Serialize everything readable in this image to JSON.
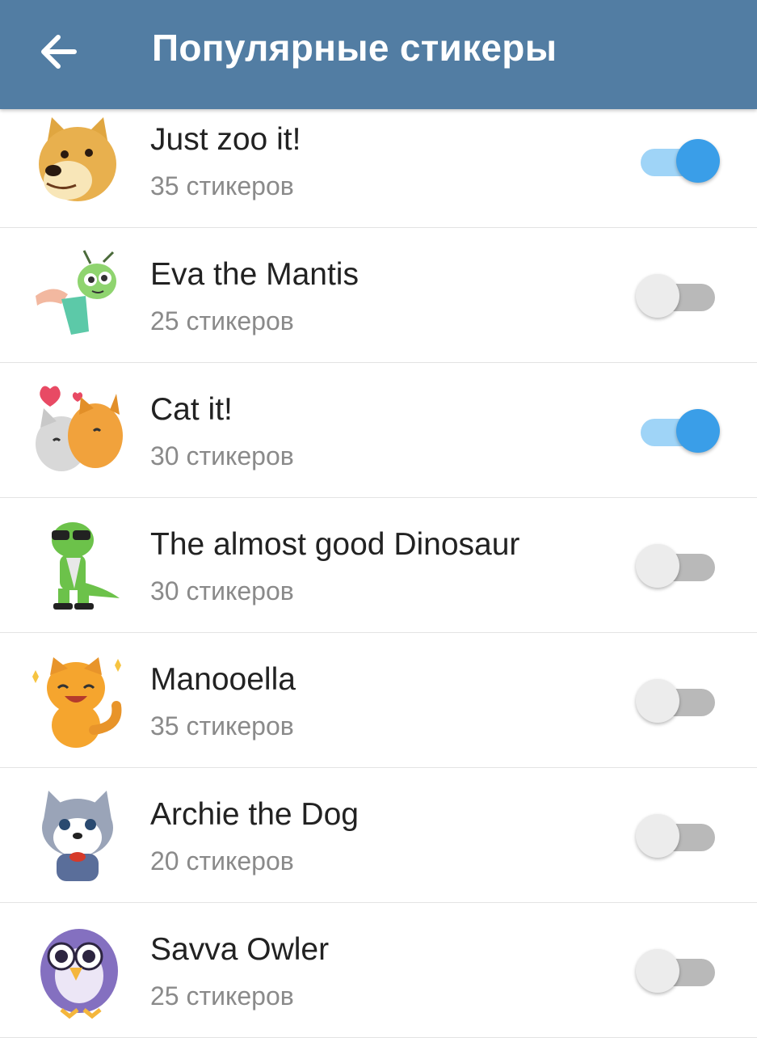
{
  "header": {
    "back_icon": "arrow-back-icon",
    "title": "Популярные стикеры",
    "background": "#527da3"
  },
  "packs": [
    {
      "name": "Just zoo it!",
      "count": "35 стикеров",
      "enabled": true,
      "icon": "doge-sticker"
    },
    {
      "name": "Eva the Mantis",
      "count": "25 стикеров",
      "enabled": false,
      "icon": "mantis-sticker"
    },
    {
      "name": "Cat it!",
      "count": "30 стикеров",
      "enabled": true,
      "icon": "cats-hug-sticker"
    },
    {
      "name": "The almost good Dinosaur",
      "count": "30 стикеров",
      "enabled": false,
      "icon": "dinosaur-sticker"
    },
    {
      "name": "Manooella",
      "count": "35 стикеров",
      "enabled": false,
      "icon": "orange-cat-sticker"
    },
    {
      "name": "Archie the Dog",
      "count": "20 стикеров",
      "enabled": false,
      "icon": "husky-dog-sticker"
    },
    {
      "name": "Savva Owler",
      "count": "25 стикеров",
      "enabled": false,
      "icon": "owl-sticker"
    }
  ],
  "colors": {
    "toggle_on_knob": "#3a9ee8",
    "toggle_on_track": "#9fd4f7",
    "toggle_off_knob": "#ececec",
    "toggle_off_track": "#b9b9b9"
  }
}
